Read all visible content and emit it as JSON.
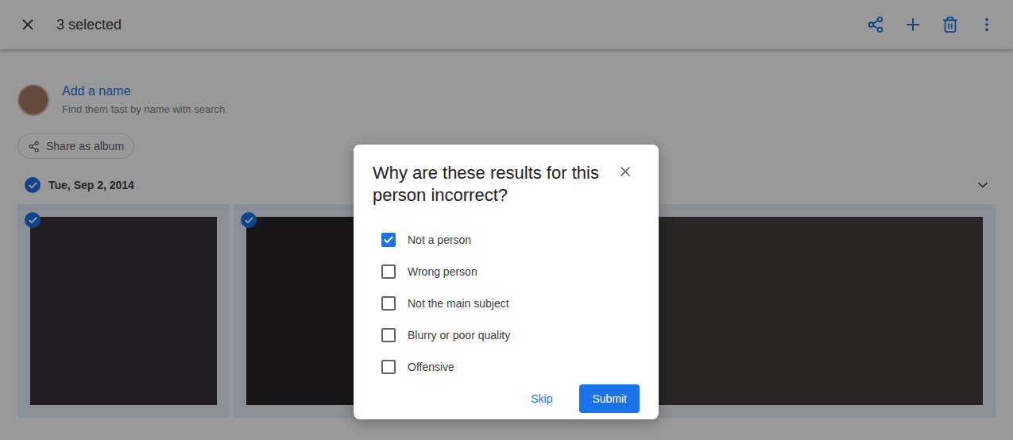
{
  "toolbar": {
    "selection_count": "3 selected"
  },
  "person": {
    "name_placeholder": "Add a name",
    "hint": "Find them fast by name with search"
  },
  "share_button": "Share as album",
  "date_group": {
    "label": "Tue, Sep 2, 2014",
    "selected": true
  },
  "photos": [
    {
      "selected": true
    },
    {
      "selected": true
    },
    {
      "selected": true
    }
  ],
  "dialog": {
    "title": "Why are these results for this person incorrect?",
    "options": [
      {
        "label": "Not a person",
        "checked": true
      },
      {
        "label": "Wrong person",
        "checked": false
      },
      {
        "label": "Not the main subject",
        "checked": false
      },
      {
        "label": "Blurry or poor quality",
        "checked": false
      },
      {
        "label": "Offensive",
        "checked": false
      }
    ],
    "buttons": [
      {
        "label": "Skip",
        "primary": false
      },
      {
        "label": "Submit",
        "primary": true
      }
    ]
  }
}
